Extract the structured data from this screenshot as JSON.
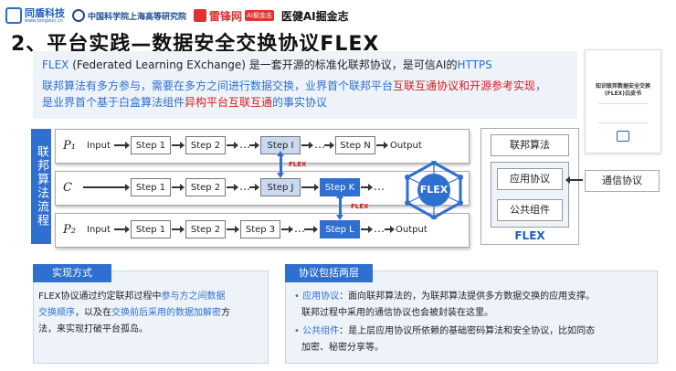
{
  "header": {
    "logo1_name": "同盾科技",
    "logo1_url": "www.tongdun.cn",
    "logo2_name": "中国科学院上海高等研究院",
    "logo3_name": "雷锋网",
    "logo3_tag": "AI掘金志",
    "logo4_name": "医健AI掘金志"
  },
  "title": "2、平台实践—数据安全交换协议FLEX",
  "intro": {
    "line1_pre": "FLEX",
    "line1_mid": " (Federated Learning EXchange) 是一套开源的标准化联邦协议，是可信AI的",
    "line1_post": "HTTPS",
    "line2_pre": "联邦算法有多方参与，需要在多方之间进行数据交换，业界首个联邦平台",
    "line2_red": "互联互通协议和开源参考实现",
    "line2_post": "，",
    "line3_pre": "是业界首个基于白盒算法组件",
    "line3_red": "异构平台互联互通",
    "line3_post": "的事实协议"
  },
  "doc": {
    "title": "知识联邦数据安全交换(FLEX)白皮书"
  },
  "diagram": {
    "side_label": "联邦算法流程",
    "lanes": [
      {
        "name": "P₁",
        "input": "Input",
        "steps": [
          "Step 1",
          "Step 2",
          "Step I",
          "Step N"
        ],
        "output": "Output"
      },
      {
        "name": "C",
        "steps": [
          "Step 1",
          "Step 2",
          "Step J",
          "Step K"
        ]
      },
      {
        "name": "P₂",
        "input": "Input",
        "steps": [
          "Step 1",
          "Step 2",
          "Step 3",
          "Step L"
        ],
        "output": "Output"
      }
    ],
    "flex_label": "FLEX",
    "hub_label": "FLEX"
  },
  "panel": {
    "top": "联邦算法",
    "mid": "应用协议",
    "bottom": "公共组件",
    "footer": "FLEX",
    "comm": "通信协议"
  },
  "bottom_left": {
    "tag": "实现方式",
    "line1_pre": "FLEX协议通过约定联邦过程中",
    "line1_blue": "参与方之间数据",
    "line2_blue": "交换顺序",
    "line2_mid": "，以及在",
    "line2_blue2": "交换前后采用的数据加解密",
    "line2_post": "方",
    "line3": "法，来实现打破平台孤岛。"
  },
  "bottom_right": {
    "tag": "协议包括两层",
    "item1_key": "应用协议",
    "item1_text": "：面向联邦算法的，为联邦算法提供多方数据交换的应用支撑。",
    "item1_line2": "联邦过程中采用的通信协议也会被封装在这里。",
    "item2_key": "公共组件",
    "item2_text": "：是上层应用协议所依赖的基础密码算法和安全协议，比如同态",
    "item2_line2": "加密、秘密分享等。"
  },
  "colors": {
    "accent": "#2f6fd0",
    "highlight": "#d22020"
  }
}
